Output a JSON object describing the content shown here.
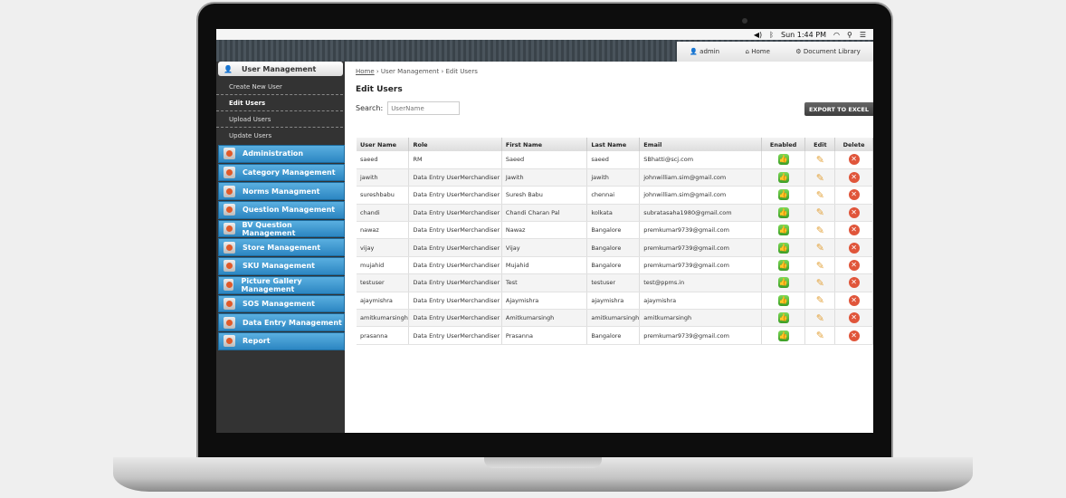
{
  "menubar": {
    "time": "Sun 1:44 PM",
    "icons": [
      "volume-icon",
      "bluetooth-icon",
      "wifi-icon",
      "spotlight-icon",
      "list-icon"
    ]
  },
  "toptabs": {
    "user": "admin",
    "home": "Home",
    "library": "Document Library"
  },
  "sidebar": {
    "section": "User Management",
    "subitems": [
      {
        "label": "Create New User"
      },
      {
        "label": "Edit Users",
        "active": true
      },
      {
        "label": "Upload Users"
      },
      {
        "label": "Update Users"
      }
    ],
    "items": [
      "Administration",
      "Category Management",
      "Norms Managment",
      "Question Management",
      "BV Question Management",
      "Store Management",
      "SKU Management",
      "Picture Gallery Management",
      "SOS Management",
      "Data Entry Management",
      "Report"
    ]
  },
  "breadcrumb": [
    "Home",
    "User Management",
    "Edit Users"
  ],
  "page_title": "Edit Users",
  "search": {
    "label": "Search:",
    "placeholder": "UserName"
  },
  "export_label": "EXPORT TO EXCEL",
  "colors": {
    "accent": "#2c86c2",
    "enabled": "#3b9e25",
    "delete": "#e0553a"
  },
  "table": {
    "headers": [
      "User Name",
      "Role",
      "First Name",
      "Last Name",
      "Email",
      "Enabled",
      "Edit",
      "Delete"
    ],
    "rows": [
      [
        "saeed",
        "RM",
        "Saeed",
        "saeed",
        "SBhatti@scj.com"
      ],
      [
        "jawith",
        "Data Entry UserMerchandiser",
        "Jawith",
        "jawith",
        "johnwilliam.sim@gmail.com"
      ],
      [
        "sureshbabu",
        "Data Entry UserMerchandiser",
        "Suresh Babu",
        "chennai",
        "johnwilliam.sim@gmail.com"
      ],
      [
        "chandi",
        "Data Entry UserMerchandiser",
        "Chandi Charan Pal",
        "kolkata",
        "subratasaha1980@gmail.com"
      ],
      [
        "nawaz",
        "Data Entry UserMerchandiser",
        "Nawaz",
        "Bangalore",
        "premkumar9739@gmail.com"
      ],
      [
        "vijay",
        "Data Entry UserMerchandiser",
        "Vijay",
        "Bangalore",
        "premkumar9739@gmail.com"
      ],
      [
        "mujahid",
        "Data Entry UserMerchandiser",
        "Mujahid",
        "Bangalore",
        "premkumar9739@gmail.com"
      ],
      [
        "testuser",
        "Data Entry UserMerchandiser",
        "Test",
        "testuser",
        "test@ppms.in"
      ],
      [
        "ajaymishra",
        "Data Entry UserMerchandiser",
        "Ajaymishra",
        "ajaymishra",
        "ajaymishra"
      ],
      [
        "amitkumarsingh",
        "Data Entry UserMerchandiser",
        "Amitkumarsingh",
        "amitkumarsingh",
        "amitkumarsingh"
      ],
      [
        "prasanna",
        "Data Entry UserMerchandiser",
        "Prasanna",
        "Bangalore",
        "premkumar9739@gmail.com"
      ]
    ]
  }
}
